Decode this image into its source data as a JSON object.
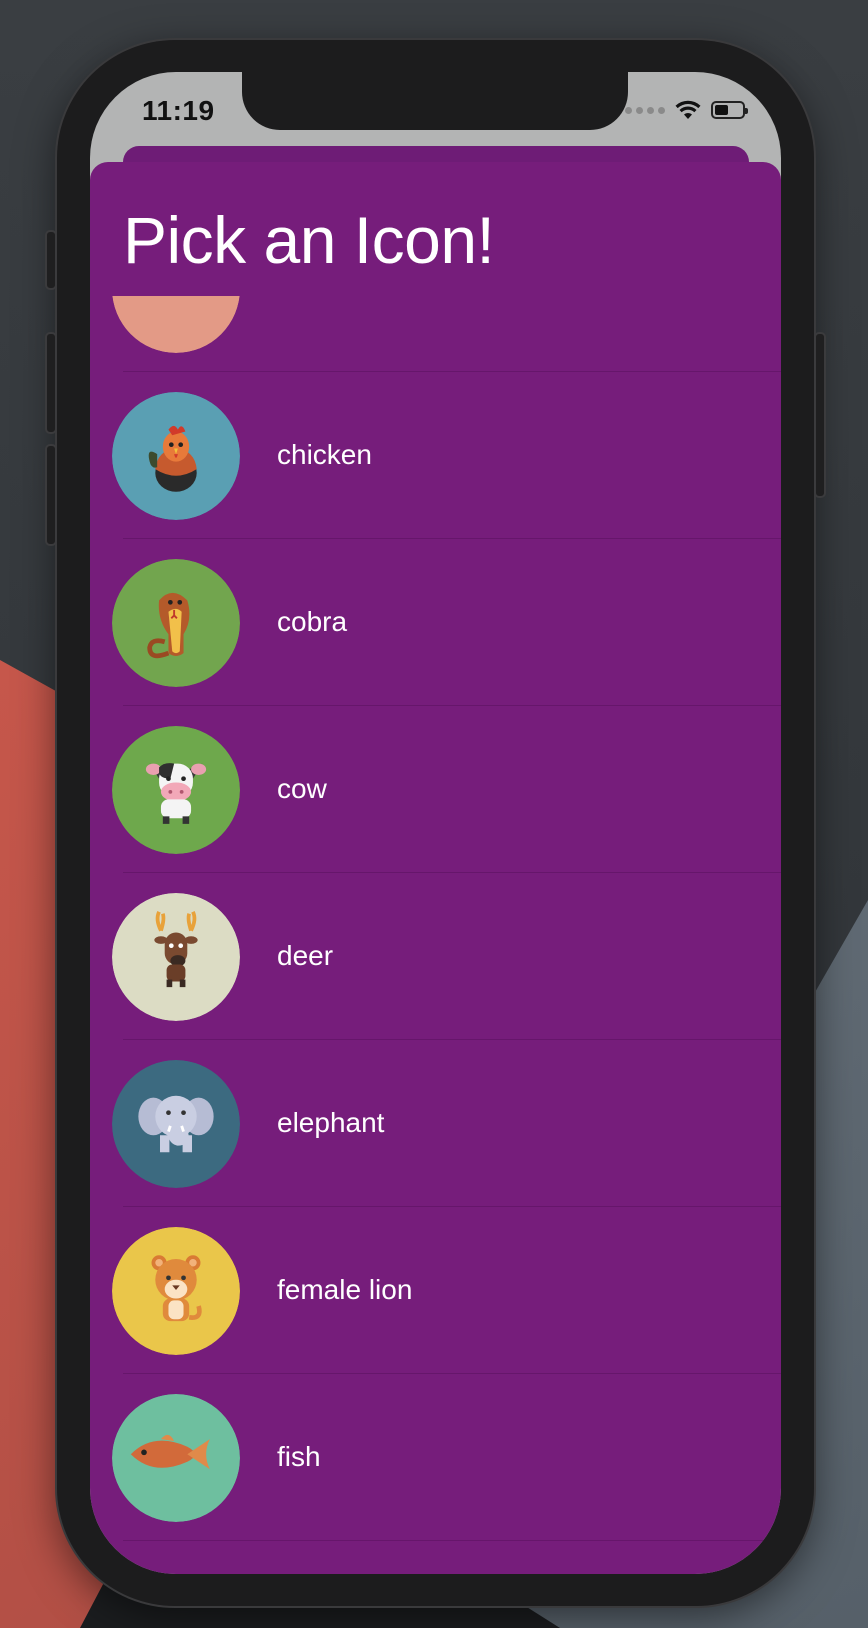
{
  "status_bar": {
    "time": "11:19",
    "battery_level": 0.5
  },
  "sheet": {
    "title": "Pick an Icon!"
  },
  "list": {
    "items": [
      {
        "label": "",
        "icon": "partial-avatar-icon",
        "color": "#e39a86"
      },
      {
        "label": "chicken",
        "icon": "chicken-icon",
        "color": "#5a9fb3"
      },
      {
        "label": "cobra",
        "icon": "cobra-icon",
        "color": "#72a54e"
      },
      {
        "label": "cow",
        "icon": "cow-icon",
        "color": "#6ea84c"
      },
      {
        "label": "deer",
        "icon": "deer-icon",
        "color": "#dcdcc4"
      },
      {
        "label": "elephant",
        "icon": "elephant-icon",
        "color": "#3c6a80"
      },
      {
        "label": "female lion",
        "icon": "female-lion-icon",
        "color": "#eac64a"
      },
      {
        "label": "fish",
        "icon": "fish-icon",
        "color": "#6ebf9f"
      }
    ]
  },
  "colors": {
    "sheet_background": "#761d7b",
    "text": "#ffffff"
  }
}
